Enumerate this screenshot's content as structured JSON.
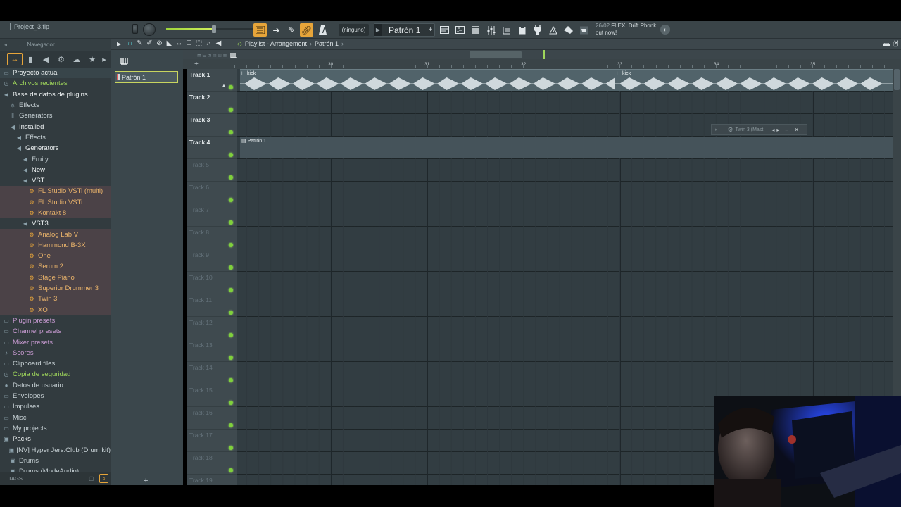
{
  "window": {
    "project_title": "Project_3.flp"
  },
  "toolbar": {
    "pattern_mode": "(ninguno)",
    "pattern_name": "Patrón 1",
    "news_date": "26/02",
    "news_text_1": "FLEX: Drift Phonk",
    "news_text_2": "out now!",
    "master_volume_pct": 55
  },
  "browser": {
    "header": "Navegador",
    "items": [
      {
        "label": "Proyecto actual",
        "icon": "folder-icon",
        "indent": 1,
        "style": "white"
      },
      {
        "label": "Archivos recientes",
        "icon": "clock-folder-icon",
        "indent": 1,
        "style": "green"
      },
      {
        "label": "Base de datos de plugins",
        "icon": "plugin-db-icon",
        "indent": 1,
        "style": "white"
      },
      {
        "label": "Effects",
        "icon": "effects-icon",
        "indent": 2,
        "style": "normal"
      },
      {
        "label": "Generators",
        "icon": "generators-icon",
        "indent": 2,
        "style": "normal"
      },
      {
        "label": "Installed",
        "icon": "plug-icon",
        "indent": 2,
        "style": "white"
      },
      {
        "label": "Effects",
        "icon": "plug-icon",
        "indent": 3,
        "style": "normal"
      },
      {
        "label": "Generators",
        "icon": "plug-icon",
        "indent": 3,
        "style": "white"
      },
      {
        "label": "Fruity",
        "icon": "plug-icon",
        "indent": 4,
        "style": "normal"
      },
      {
        "label": "New",
        "icon": "plug-icon",
        "indent": 4,
        "style": "white"
      },
      {
        "label": "VST",
        "icon": "plug-icon",
        "indent": 4,
        "style": "white"
      },
      {
        "label": "FL Studio VSTi (multi)",
        "icon": "plugin-gear-icon",
        "indent": 5,
        "style": "plug"
      },
      {
        "label": "FL Studio VSTi",
        "icon": "plugin-gear-icon",
        "indent": 5,
        "style": "plug"
      },
      {
        "label": "Kontakt 8",
        "icon": "plugin-gear-icon",
        "indent": 5,
        "style": "plug"
      },
      {
        "label": "VST3",
        "icon": "plug-icon",
        "indent": 4,
        "style": "white"
      },
      {
        "label": "Analog Lab V",
        "icon": "plugin-gear-icon",
        "indent": 5,
        "style": "plug"
      },
      {
        "label": "Hammond B-3X",
        "icon": "plugin-gear-icon",
        "indent": 5,
        "style": "plug"
      },
      {
        "label": "One",
        "icon": "plugin-gear-icon",
        "indent": 5,
        "style": "plug"
      },
      {
        "label": "Serum 2",
        "icon": "plugin-gear-icon",
        "indent": 5,
        "style": "plug"
      },
      {
        "label": "Stage Piano",
        "icon": "plugin-gear-icon",
        "indent": 5,
        "style": "plug"
      },
      {
        "label": "Superior Drummer 3",
        "icon": "plugin-gear-icon",
        "indent": 5,
        "style": "plug"
      },
      {
        "label": "Twin 3",
        "icon": "plugin-gear-icon",
        "indent": 5,
        "style": "plug"
      },
      {
        "label": "XO",
        "icon": "plugin-gear-icon",
        "indent": 5,
        "style": "plug"
      },
      {
        "label": "Plugin presets",
        "icon": "folder-icon",
        "indent": 1,
        "style": "purple"
      },
      {
        "label": "Channel presets",
        "icon": "folder-icon",
        "indent": 1,
        "style": "purple"
      },
      {
        "label": "Mixer presets",
        "icon": "folder-icon",
        "indent": 1,
        "style": "purple"
      },
      {
        "label": "Scores",
        "icon": "note-icon",
        "indent": 1,
        "style": "purple"
      },
      {
        "label": "Clipboard files",
        "icon": "folder-icon",
        "indent": 1,
        "style": "normal"
      },
      {
        "label": "Copia de seguridad",
        "icon": "backup-folder-icon",
        "indent": 1,
        "style": "green"
      },
      {
        "label": "Datos de usuario",
        "icon": "user-icon",
        "indent": 1,
        "style": "normal"
      },
      {
        "label": "Envelopes",
        "icon": "folder-icon",
        "indent": 1,
        "style": "normal"
      },
      {
        "label": "Impulses",
        "icon": "folder-icon",
        "indent": 1,
        "style": "normal"
      },
      {
        "label": "Misc",
        "icon": "folder-icon",
        "indent": 1,
        "style": "normal"
      },
      {
        "label": "My projects",
        "icon": "folder-icon",
        "indent": 1,
        "style": "normal"
      },
      {
        "label": "Packs",
        "icon": "pack-folder-icon",
        "indent": 1,
        "style": "white"
      },
      {
        "label": "[NV] Hyper Jers.Club (Drum kit)",
        "icon": "pack-folder-icon",
        "indent": 2,
        "style": "normal"
      },
      {
        "label": "Drums",
        "icon": "pack-folder-icon",
        "indent": 2,
        "style": "normal"
      },
      {
        "label": "Drums (ModeAudio)",
        "icon": "pack-folder-icon",
        "indent": 2,
        "style": "normal"
      }
    ],
    "footer_tags": "TAGS"
  },
  "picker": {
    "items": [
      "Patrón 1"
    ]
  },
  "playlist": {
    "breadcrumb": [
      "Playlist - Arrangement",
      "Patrón 1"
    ],
    "ruler_marks": [
      "30",
      "31",
      "32",
      "33",
      "34",
      "35"
    ],
    "tracks": [
      "Track 1",
      "Track 2",
      "Track 3",
      "Track 4",
      "Track 5",
      "Track 6",
      "Track 7",
      "Track 8",
      "Track 9",
      "Track 10",
      "Track 11",
      "Track 12",
      "Track 13",
      "Track 14",
      "Track 15",
      "Track 16",
      "Track 17",
      "Track 18",
      "Track 19"
    ],
    "active_tracks": 4,
    "clips": [
      {
        "label": "kick",
        "track": 1,
        "type": "audio"
      },
      {
        "label": "kick",
        "track": 1,
        "type": "audio"
      },
      {
        "label": "Patrón 1",
        "track": 4,
        "type": "pattern"
      }
    ],
    "floating_window": "Twin 3 (Mast"
  },
  "colors": {
    "accent": "#e7a53a",
    "led": "#7fd13b",
    "plugin_text": "#e9b36b",
    "grid_bg": "#323d42"
  }
}
